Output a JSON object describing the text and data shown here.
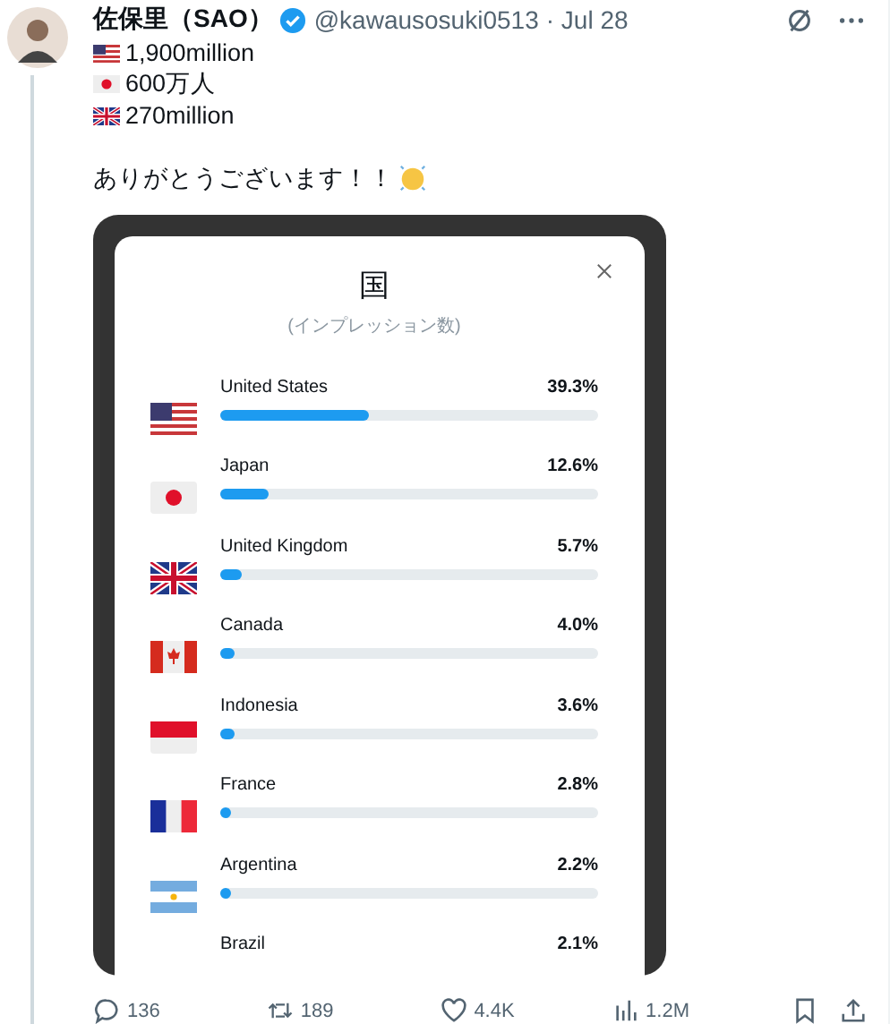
{
  "post": {
    "author": "佐保里（SAO）",
    "verified": true,
    "handle": "@kawausosuki0513",
    "date": "· Jul 28",
    "lines": [
      {
        "kind": "us",
        "text": "1,900million"
      },
      {
        "kind": "jp",
        "text": "600万人"
      },
      {
        "kind": "uk",
        "text": "270million"
      }
    ],
    "greeting": "ありがとうございます！！"
  },
  "screenshot": {
    "title": "国",
    "subtitle": "(インプレッション数)",
    "rows": [
      {
        "kind": "us",
        "country": "United States",
        "percent": "39.3%",
        "level": 0.393
      },
      {
        "kind": "jp",
        "country": "Japan",
        "percent": "12.6%",
        "level": 0.126
      },
      {
        "kind": "uk",
        "country": "United Kingdom",
        "percent": "5.7%",
        "level": 0.057
      },
      {
        "kind": "ca",
        "country": "Canada",
        "percent": "4.0%",
        "level": 0.04
      },
      {
        "kind": "id",
        "country": "Indonesia",
        "percent": "3.6%",
        "level": 0.036
      },
      {
        "kind": "fr",
        "country": "France",
        "percent": "2.8%",
        "level": 0.028
      },
      {
        "kind": "ar",
        "country": "Argentina",
        "percent": "2.2%",
        "level": 0.022
      },
      {
        "kind": "none",
        "country": "Brazil",
        "percent": "2.1%"
      }
    ]
  },
  "actions": [
    {
      "kind": "reply",
      "count": "136"
    },
    {
      "kind": "repost",
      "count": "189"
    },
    {
      "kind": "like",
      "count": "4.4K"
    },
    {
      "kind": "views",
      "count": "1.2M"
    },
    {
      "kind": "bookmark"
    },
    {
      "kind": "share"
    }
  ]
}
